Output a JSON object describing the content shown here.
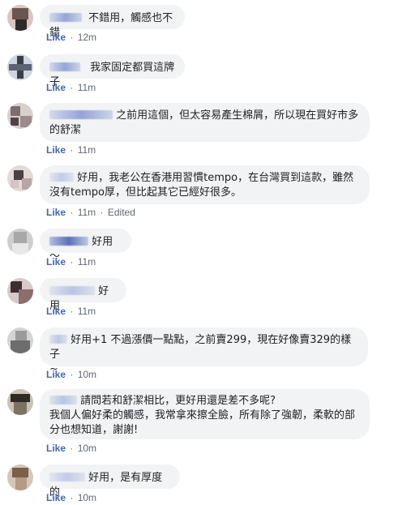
{
  "comments": [
    {
      "text": "不錯用，觸感也不錯",
      "like": "Like",
      "time": "12m"
    },
    {
      "text": "我家固定都買這牌子",
      "like": "Like",
      "time": "11m"
    },
    {
      "text_line1": "之前用這個，但太容易產生棉屑，所以現在買好市多",
      "text_line2": "的舒潔",
      "like": "Like",
      "time": "11m"
    },
    {
      "text_line1": "好用，我老公在香港用習慣tempo，在台灣買到這款，雖然",
      "text_line2": "沒有tempo厚，但比起其它已經好很多。",
      "like": "Like",
      "time": "11m",
      "edited": "Edited"
    },
    {
      "text": "好用～",
      "like": "Like",
      "time": "11m"
    },
    {
      "text": "好用",
      "like": "Like",
      "time": "11m"
    },
    {
      "text_line1": "好用+1 不過漲價一點點，之前賣299，現在好像賣329的樣子",
      "text_line2": "~",
      "like": "Like",
      "time": "10m"
    },
    {
      "text_line1": "請問若和舒潔相比，更好用還是差不多呢?",
      "text_line2": "我個人偏好柔的觸感，我常拿來擦全臉，所有除了強韌，柔軟的部",
      "text_line3": "分也想知道，謝謝!",
      "like": "Like",
      "time": "10m"
    },
    {
      "text": "好用，是有厚度的",
      "like": "Like",
      "time": "10m"
    }
  ]
}
